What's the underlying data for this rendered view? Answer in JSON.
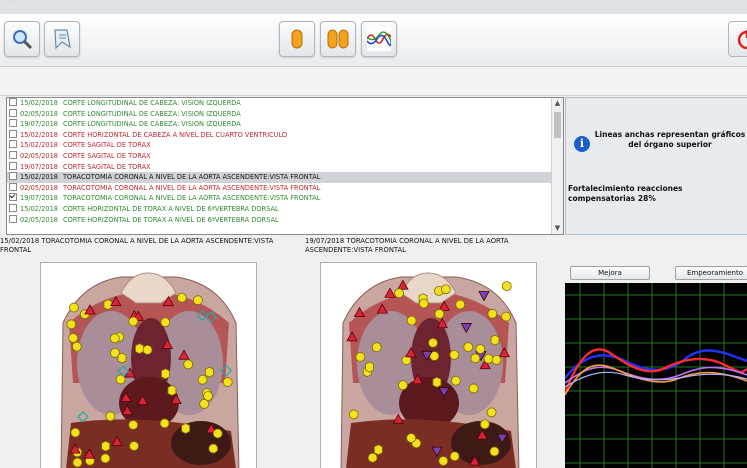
{
  "window": {
    "title": "..."
  },
  "toolbar": {
    "buttons": [
      {
        "name": "search-button",
        "icon": "magnifier-icon"
      },
      {
        "name": "bookmark-button",
        "icon": "bookmark-icon"
      },
      {
        "name": "single-view-button",
        "icon": "single-capsule-icon"
      },
      {
        "name": "compare-view-button",
        "icon": "double-capsule-icon"
      },
      {
        "name": "graph-view-button",
        "icon": "wave-graph-icon"
      }
    ]
  },
  "records": [
    {
      "date": "15/02/2018",
      "text": "CORTE LONGITUDINAL DE CABEZA: VISION IZQUERDA",
      "color": "#2e8b2e",
      "checked": false,
      "selected": false
    },
    {
      "date": "02/05/2018",
      "text": "CORTE LONGITUDINAL DE CABEZA: VISION IZQUERDA",
      "color": "#2e8b2e",
      "checked": false,
      "selected": false
    },
    {
      "date": "19/07/2018",
      "text": "CORTE LONGITUDINAL DE CABEZA: VISION IZQUERDA",
      "color": "#2e8b2e",
      "checked": false,
      "selected": false
    },
    {
      "date": "15/02/2018",
      "text": "CORTE HORIZONTAL DE CABEZA A NIVEL DEL CUARTO VENTRICULO",
      "color": "#c0282d",
      "checked": false,
      "selected": false
    },
    {
      "date": "15/02/2018",
      "text": "CORTE SAGITAL DE TORAX",
      "color": "#c0282d",
      "checked": false,
      "selected": false
    },
    {
      "date": "02/05/2018",
      "text": "CORTE SAGITAL DE TORAX",
      "color": "#c0282d",
      "checked": false,
      "selected": false
    },
    {
      "date": "19/07/2018",
      "text": "CORTE SAGITAL DE TORAX",
      "color": "#c0282d",
      "checked": false,
      "selected": false
    },
    {
      "date": "15/02/2018",
      "text": "TORACOTOMIA CORONAL A NIVEL DE LA AORTA ASCENDENTE:VISTA FRONTAL",
      "color": "#111111",
      "checked": false,
      "selected": true
    },
    {
      "date": "02/05/2018",
      "text": "TORACOTOMIA CORONAL A NIVEL DE LA AORTA ASCENDENTE:VISTA FRONTAL",
      "color": "#c0282d",
      "checked": false,
      "selected": false
    },
    {
      "date": "19/07/2018",
      "text": "TORACOTOMIA CORONAL A NIVEL DE LA AORTA ASCENDENTE:VISTA FRONTAL",
      "color": "#2e8b2e",
      "checked": true,
      "selected": false
    },
    {
      "date": "15/02/2018",
      "text": "CORTE HORIZONTAL DE TORAX A NIVEL DE 6ªVERTEBRA DORSAL",
      "color": "#2e8b2e",
      "checked": false,
      "selected": false
    },
    {
      "date": "02/05/2018",
      "text": "CORTE HORIZONTAL DE TORAX A NIVEL DE 6ªVERTEBRA DORSAL",
      "color": "#2e8b2e",
      "checked": false,
      "selected": false
    }
  ],
  "info": {
    "message": "Lineas anchas representan gráficos del órgano superior",
    "fortalecimiento": "Fortalecimiento reacciones compensatorias 28%"
  },
  "left_view": {
    "caption": "15/02/2018  TORACOTOMIA CORONAL A NIVEL DE LA AORTA ASCENDENTE:VISTA FRONTAL"
  },
  "right_view": {
    "caption": "19/07/2018  TORACOTOMIA CORONAL A NIVEL DE LA AORTA ASCENDENTE:VISTA FRONTAL"
  },
  "tabs": {
    "mejora": "Mejora",
    "empeoramiento": "Empeoramiento"
  },
  "colors": {
    "marker_red": "#d9233a",
    "marker_yellow": "#f5e11b",
    "marker_purple": "#7a3fb0",
    "marker_teal": "#2aa6a6",
    "chart_bg": "#000000",
    "chart_grid": "#1f7a1f"
  }
}
